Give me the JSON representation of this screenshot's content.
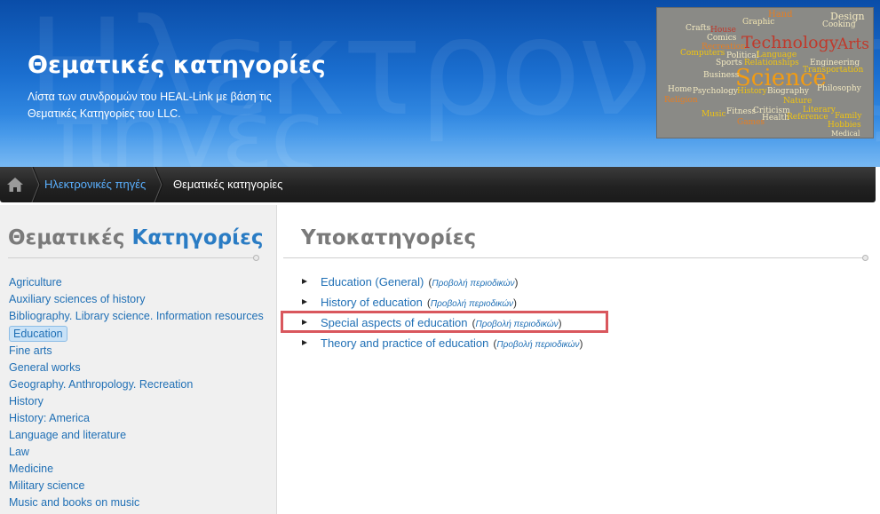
{
  "header": {
    "title": "Θεματικές κατηγορίες",
    "subtitle": "Λίστα των συνδρομών του HEAL-Link με βάση τις Θεματικές Κατηγορίες του LLC.",
    "watermark_line1": "Ηλεκτρονικές",
    "watermark_line2": "πηγές"
  },
  "wordcloud": {
    "words": [
      {
        "text": "Crafts",
        "color": "#f3e9c0"
      },
      {
        "text": "House",
        "color": "#c0392b"
      },
      {
        "text": "Graphic",
        "color": "#f1e4b0"
      },
      {
        "text": "Hand",
        "color": "#e67e22"
      },
      {
        "text": "Design",
        "color": "#f3e9c0"
      },
      {
        "text": "Comics",
        "color": "#f3e9c0"
      },
      {
        "text": "Technology",
        "color": "#c0392b"
      },
      {
        "text": "Arts",
        "color": "#c0392b"
      },
      {
        "text": "Cooking",
        "color": "#f3e9c0"
      },
      {
        "text": "Computers",
        "color": "#f1c40f"
      },
      {
        "text": "Recreation",
        "color": "#e67e22"
      },
      {
        "text": "Political",
        "color": "#f3e9c0"
      },
      {
        "text": "Language",
        "color": "#f1c40f"
      },
      {
        "text": "Engineering",
        "color": "#f3e9c0"
      },
      {
        "text": "Sports",
        "color": "#f3e9c0"
      },
      {
        "text": "Relationships",
        "color": "#f1c40f"
      },
      {
        "text": "Transportation",
        "color": "#f1c40f"
      },
      {
        "text": "Science",
        "color": "#f39c12"
      },
      {
        "text": "Business",
        "color": "#f3e9c0"
      },
      {
        "text": "Home",
        "color": "#f3e9c0"
      },
      {
        "text": "Psychology",
        "color": "#f3e9c0"
      },
      {
        "text": "History",
        "color": "#f1c40f"
      },
      {
        "text": "Biography",
        "color": "#f3e9c0"
      },
      {
        "text": "Philosophy",
        "color": "#f3e9c0"
      },
      {
        "text": "Religion",
        "color": "#e67e22"
      },
      {
        "text": "Nature",
        "color": "#f1c40f"
      },
      {
        "text": "Music",
        "color": "#f1c40f"
      },
      {
        "text": "Fitness",
        "color": "#f3e9c0"
      },
      {
        "text": "Criticism",
        "color": "#f3e9c0"
      },
      {
        "text": "Literary",
        "color": "#f1c40f"
      },
      {
        "text": "Health",
        "color": "#f3e9c0"
      },
      {
        "text": "Reference",
        "color": "#f1c40f"
      },
      {
        "text": "Family",
        "color": "#f1c40f"
      },
      {
        "text": "Games",
        "color": "#e67e22"
      },
      {
        "text": "Hobbies",
        "color": "#f1c40f"
      },
      {
        "text": "Medical",
        "color": "#f3e9c0"
      }
    ]
  },
  "breadcrumb": {
    "home_label": "home",
    "link_label": "Ηλεκτρονικές πηγές",
    "current_label": "Θεματικές κατηγορίες"
  },
  "left": {
    "heading_part1": "Θεματικές",
    "heading_part2": "Κατηγορίες",
    "categories": [
      "Agriculture",
      "Auxiliary sciences of history",
      "Bibliography. Library science. Information resources",
      "Education",
      "Fine arts",
      "General works",
      "Geography. Anthropology. Recreation",
      "History",
      "History: America",
      "Language and literature",
      "Law",
      "Medicine",
      "Military science",
      "Music and books on music"
    ],
    "selected_index": 3
  },
  "right": {
    "heading": "Υποκατηγορίες",
    "subcategories": [
      {
        "label": "Education (General)",
        "journals_label": "Προβολή περιοδικών"
      },
      {
        "label": "History of education",
        "journals_label": "Προβολή περιοδικών"
      },
      {
        "label": "Special aspects of education",
        "journals_label": "Προβολή περιοδικών"
      },
      {
        "label": "Theory and practice of education",
        "journals_label": "Προβολή περιοδικών"
      }
    ],
    "highlighted_index": 2
  },
  "colors": {
    "link": "#1f6fb5",
    "heading_accent": "#2a7cc4",
    "highlight_border": "#d9575d",
    "breadcrumb_link": "#5ab0ff"
  }
}
